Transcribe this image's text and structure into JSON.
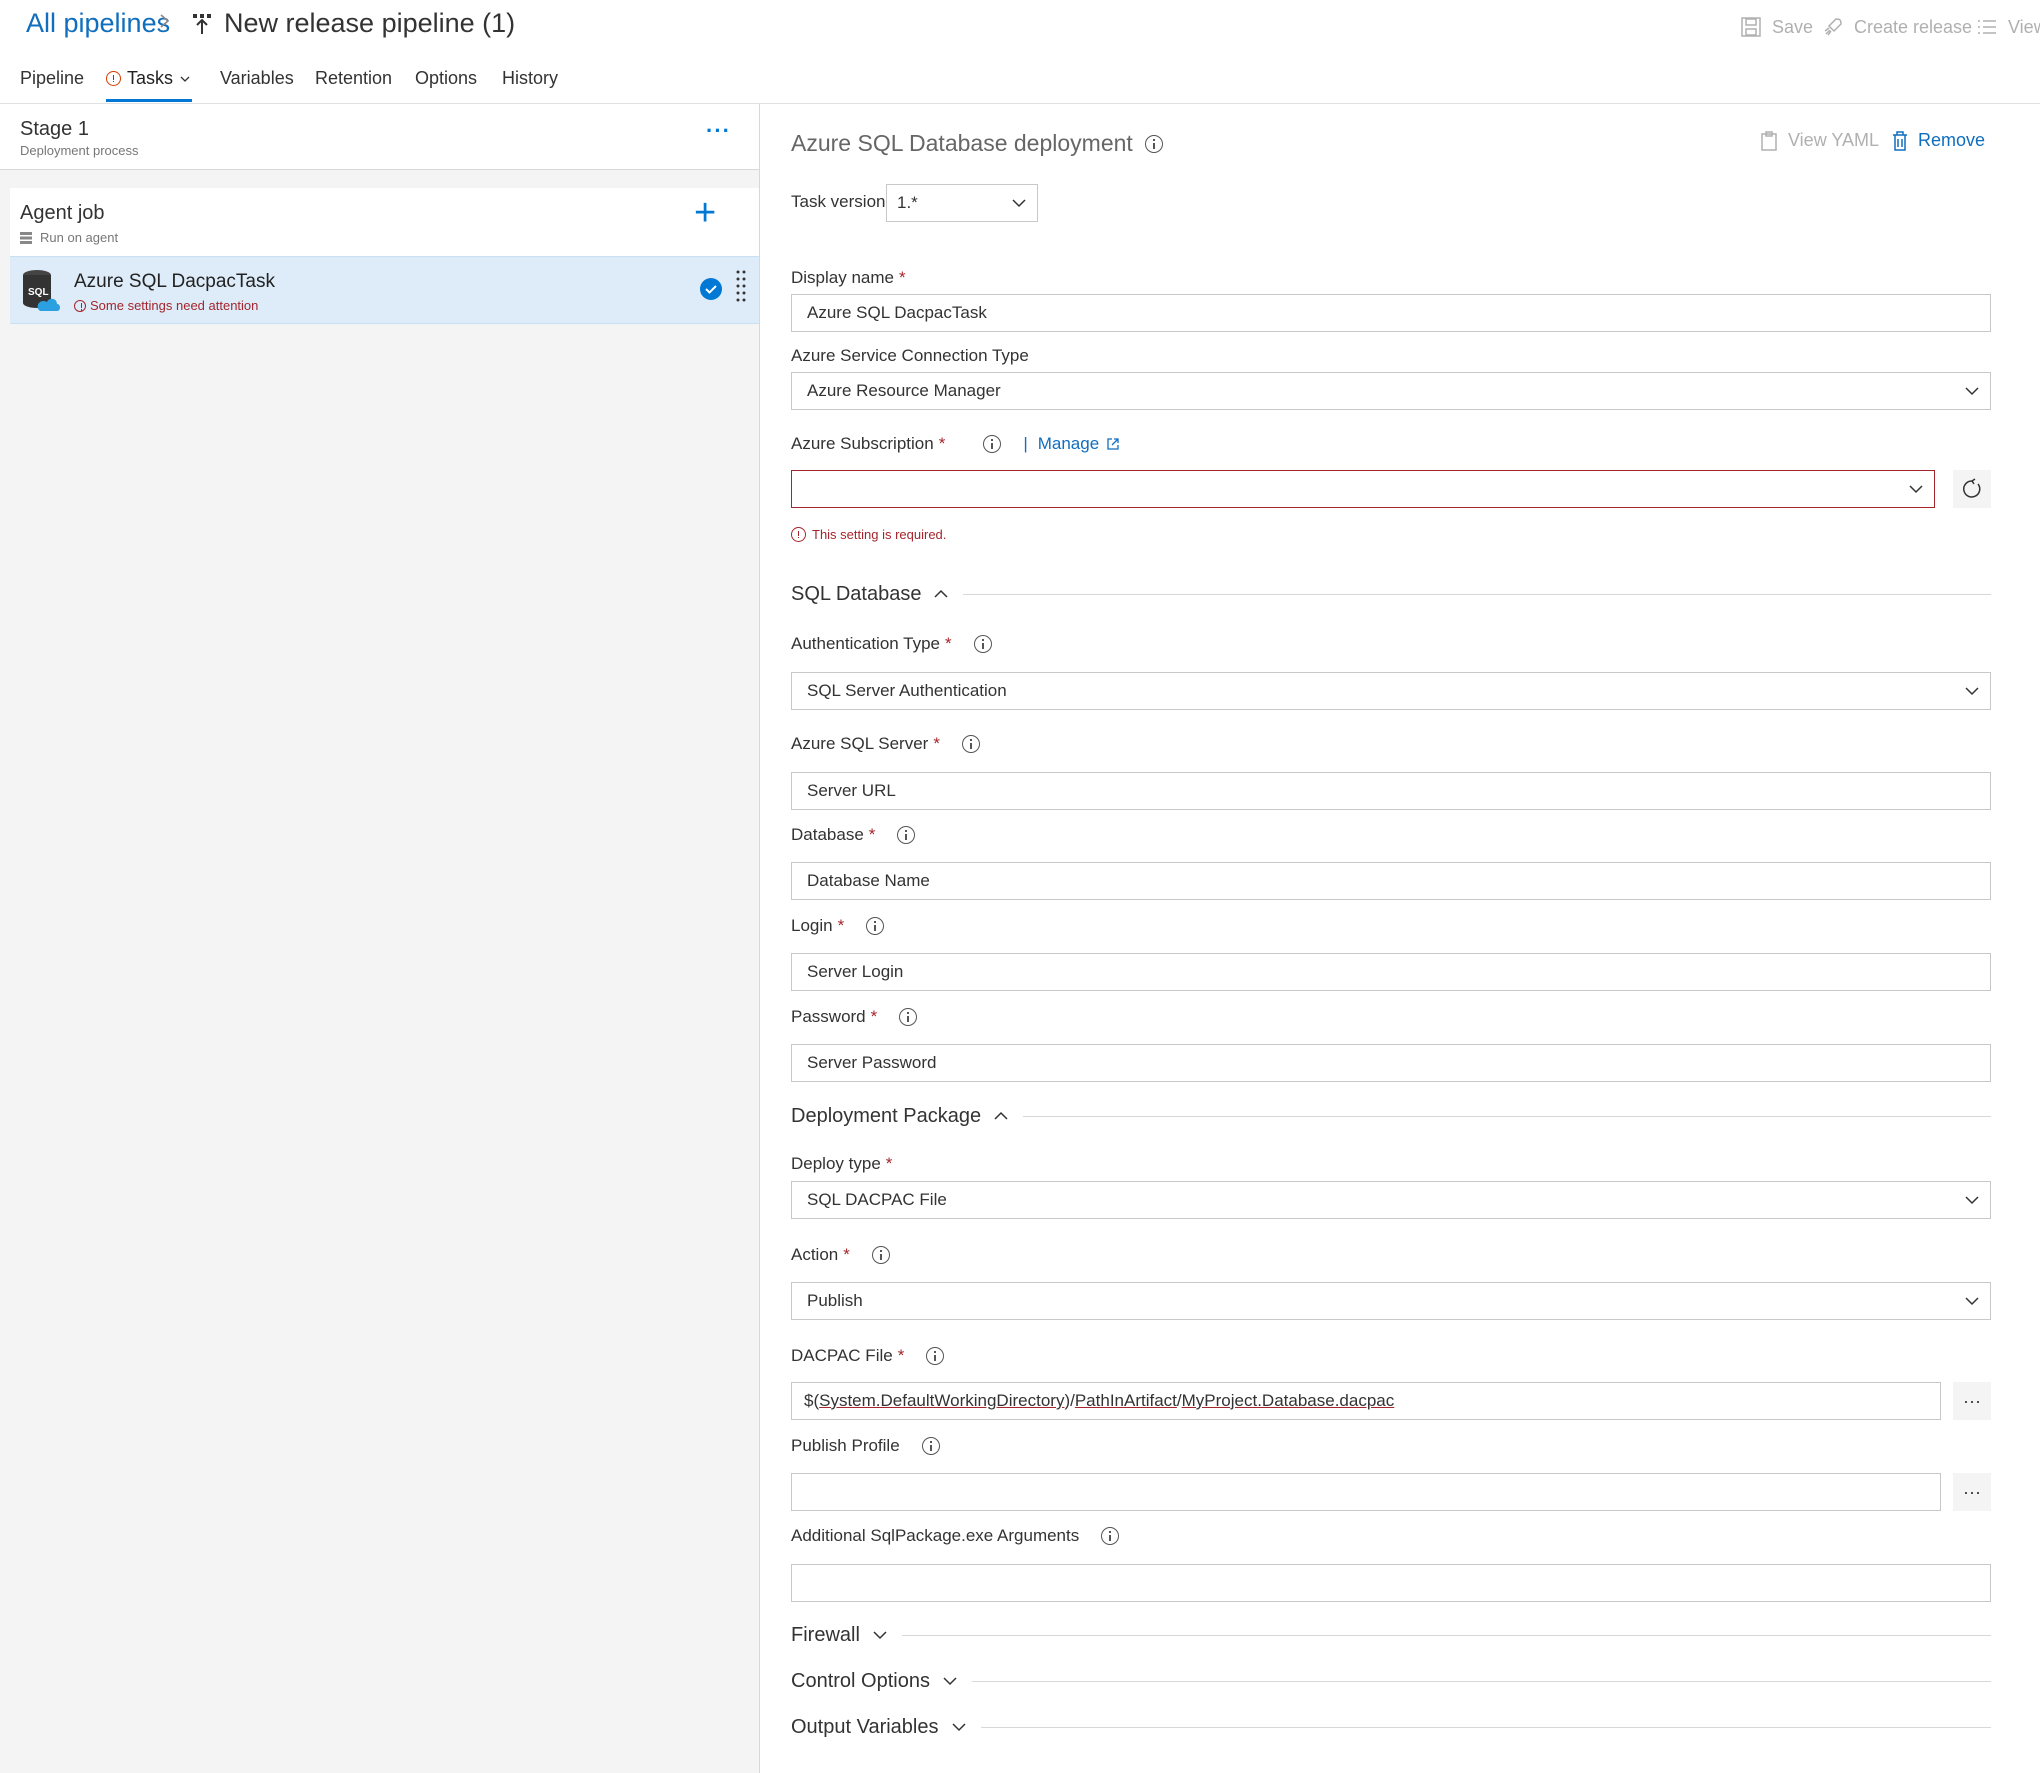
{
  "header": {
    "breadcrumb": "All pipelines",
    "title": "New release pipeline (1)",
    "actions": {
      "save": "Save",
      "create_release": "Create release",
      "view": "View"
    }
  },
  "tabs": [
    {
      "label": "Pipeline"
    },
    {
      "label": "Tasks",
      "active": true,
      "warning": true
    },
    {
      "label": "Variables"
    },
    {
      "label": "Retention"
    },
    {
      "label": "Options"
    },
    {
      "label": "History"
    }
  ],
  "stage": {
    "title": "Stage 1",
    "subtitle": "Deployment process"
  },
  "agent_job": {
    "title": "Agent job",
    "subtitle": "Run on agent"
  },
  "task": {
    "title": "Azure SQL DacpacTask",
    "warning": "Some settings need attention"
  },
  "panel": {
    "title": "Azure SQL Database deployment",
    "view_yaml": "View YAML",
    "remove": "Remove",
    "task_version_label": "Task version",
    "task_version_value": "1.*",
    "display_name_label": "Display name",
    "display_name_value": "Azure SQL DacpacTask",
    "conn_type_label": "Azure Service Connection Type",
    "conn_type_value": "Azure Resource Manager",
    "subscription_label": "Azure Subscription",
    "manage_label": "Manage",
    "subscription_value": "",
    "required_msg": "This setting is required.",
    "sql_db_section": "SQL Database",
    "auth_type_label": "Authentication Type",
    "auth_type_value": "SQL Server Authentication",
    "server_label": "Azure SQL Server",
    "server_placeholder": "Server URL",
    "database_label": "Database",
    "database_placeholder": "Database Name",
    "login_label": "Login",
    "login_placeholder": "Server Login",
    "password_label": "Password",
    "password_placeholder": "Server Password",
    "deploy_pkg_section": "Deployment Package",
    "deploy_type_label": "Deploy type",
    "deploy_type_value": "SQL DACPAC File",
    "action_label": "Action",
    "action_value": "Publish",
    "dacpac_label": "DACPAC File",
    "dacpac_prefix": "$(",
    "dacpac_part1": "System.DefaultWorkingDirectory",
    "dacpac_mid1": ")/",
    "dacpac_part2": "PathInArtifact",
    "dacpac_mid2": "/",
    "dacpac_part3": "MyProject.Database.dacpac",
    "publish_profile_label": "Publish Profile",
    "publish_profile_value": "",
    "additional_args_label": "Additional SqlPackage.exe Arguments",
    "additional_args_value": "",
    "firewall_section": "Firewall",
    "control_options_section": "Control Options",
    "output_variables_section": "Output Variables",
    "ellipsis": "···"
  },
  "colors": {
    "accent": "#0078d4",
    "link": "#106ebe",
    "error": "#a4262c",
    "selected_row": "#deecf9"
  }
}
